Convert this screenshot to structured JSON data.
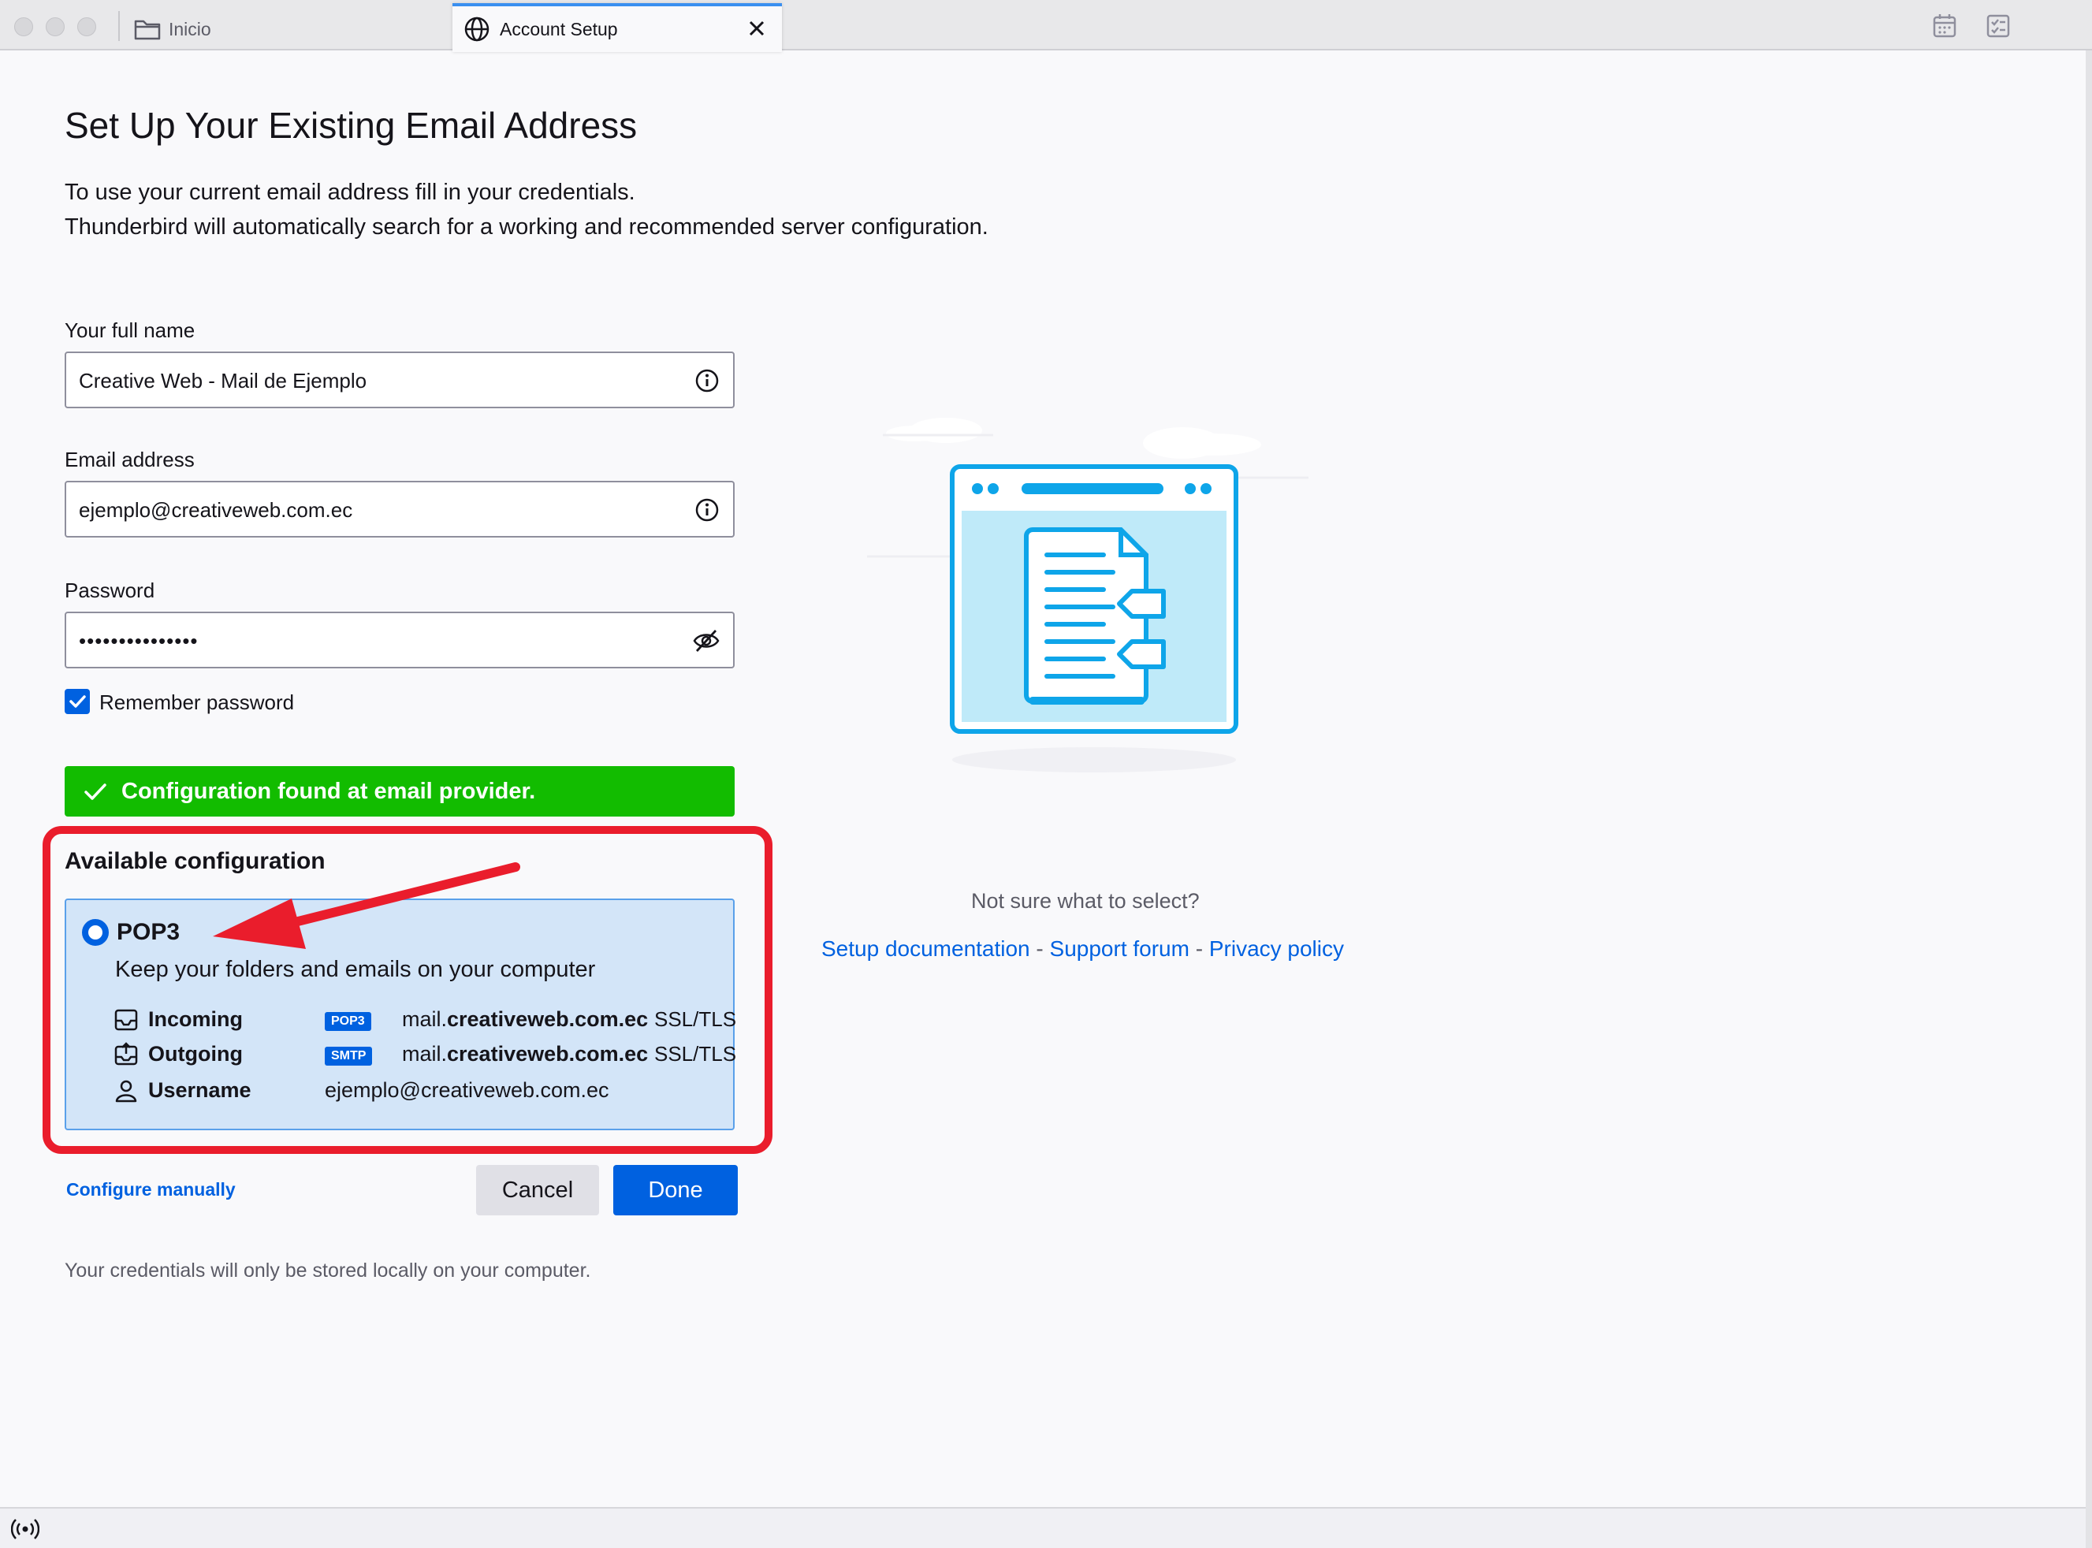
{
  "tabs": {
    "inicio": {
      "label": "Inicio"
    },
    "account": {
      "label": "Account Setup"
    }
  },
  "page": {
    "title": "Set Up Your Existing Email Address",
    "intro_line1": "To use your current email address fill in your credentials.",
    "intro_line2": "Thunderbird will automatically search for a working and recommended server configuration."
  },
  "form": {
    "full_name_label": "Your full name",
    "full_name_value": "Creative Web - Mail de Ejemplo",
    "email_label": "Email address",
    "email_value": "ejemplo@creativeweb.com.ec",
    "password_label": "Password",
    "password_value": "•••••••••••••••",
    "remember_label": "Remember password",
    "remember_checked": true
  },
  "status": {
    "found_message": "Configuration found at email provider."
  },
  "config": {
    "section_title": "Available configuration",
    "option_name": "POP3",
    "option_desc": "Keep your folders and emails on your computer",
    "incoming": {
      "label": "Incoming",
      "badge": "POP3",
      "host_prefix": "mail.",
      "host_domain": "creativeweb.com.ec",
      "security": "SSL/TLS"
    },
    "outgoing": {
      "label": "Outgoing",
      "badge": "SMTP",
      "host_prefix": "mail.",
      "host_domain": "creativeweb.com.ec",
      "security": "SSL/TLS"
    },
    "username": {
      "label": "Username",
      "value": "ejemplo@creativeweb.com.ec"
    }
  },
  "actions": {
    "configure_manually": "Configure manually",
    "cancel": "Cancel",
    "done": "Done"
  },
  "footer": {
    "note": "Your credentials will only be stored locally on your computer."
  },
  "help": {
    "question": "Not sure what to select?",
    "setup_docs": "Setup documentation",
    "sep1": " - ",
    "support_forum": "Support forum",
    "sep2": " - ",
    "privacy_policy": "Privacy policy"
  },
  "colors": {
    "accent": "#0061e0",
    "success": "#12bc00",
    "highlight": "#ea1d2c",
    "illustration": "#0ea5e9"
  }
}
